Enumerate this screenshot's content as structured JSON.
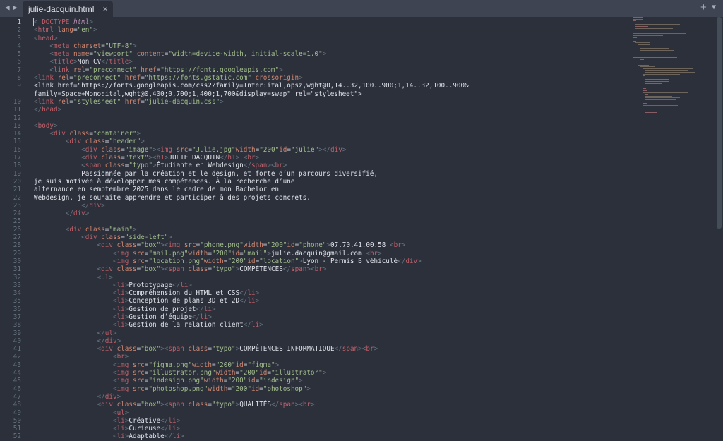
{
  "tabbar": {
    "nav_back": "◀",
    "nav_forward": "▶",
    "tab_title": "julie-dacquin.html",
    "tab_close": "×",
    "new_tab": "+",
    "menu": "▼"
  },
  "editor": {
    "active_line": 1,
    "lines": [
      {
        "n": "1",
        "t": "<!DOCTYPE html>"
      },
      {
        "n": "2",
        "t": "<html lang=\"en\">"
      },
      {
        "n": "3",
        "t": "<head>"
      },
      {
        "n": "4",
        "t": "    <meta charset=\"UTF-8\">"
      },
      {
        "n": "5",
        "t": "    <meta name=\"viewport\" content=\"width=device-width, initial-scale=1.0\">"
      },
      {
        "n": "6",
        "t": "    <title>Mon CV</title>"
      },
      {
        "n": "7",
        "t": "    <link rel=\"preconnect\" href=\"https://fonts.googleapis.com\">"
      },
      {
        "n": "8",
        "t": "<link rel=\"preconnect\" href=\"https://fonts.gstatic.com\" crossorigin>"
      },
      {
        "n": "9",
        "t": "<link href=\"https://fonts.googleapis.com/css2?family=Inter:ital,opsz,wght@0,14..32,100..900;1,14..32,100..900&"
      },
      {
        "n": "",
        "t": "family=Space+Mono:ital,wght@0,400;0,700;1,400;1,700&display=swap\" rel=\"stylesheet\">"
      },
      {
        "n": "10",
        "t": "<link rel=\"stylesheet\" href=\"julie-dacquin.css\">"
      },
      {
        "n": "11",
        "t": "</head>"
      },
      {
        "n": "12",
        "t": ""
      },
      {
        "n": "13",
        "t": "<body>"
      },
      {
        "n": "14",
        "t": "    <div class=\"container\">"
      },
      {
        "n": "15",
        "t": "        <div class=\"header\">"
      },
      {
        "n": "16",
        "t": "            <div class=\"image\"><img src=\"Julie.jpg\"width=\"200\"id=\"julie\"></div>"
      },
      {
        "n": "17",
        "t": "            <div class=\"text\"><h1>JULIE DACQUIN</h1> <br>"
      },
      {
        "n": "18",
        "t": "            <span class=\"typo\">Étudiante en Webdesign</span><br>"
      },
      {
        "n": "19",
        "t": "            Passionnée par la création et le design, et forte d’un parcours diversifié,"
      },
      {
        "n": "20",
        "t": "je suis motivée à développer mes compétences. À la recherche d’une"
      },
      {
        "n": "21",
        "t": "alternance en semptembre 2025 dans le cadre de mon Bachelor en"
      },
      {
        "n": "22",
        "t": "Webdesign, je souhaite apprendre et participer à des projets concrets."
      },
      {
        "n": "23",
        "t": "            </div>"
      },
      {
        "n": "24",
        "t": "        </div>"
      },
      {
        "n": "25",
        "t": ""
      },
      {
        "n": "26",
        "t": "        <div class=\"main\">"
      },
      {
        "n": "27",
        "t": "            <div class=\"side-left\">"
      },
      {
        "n": "28",
        "t": "                <div class=\"box\"><img src=\"phone.png\"width=\"200\"id=\"phone\">07.70.41.00.58 <br>"
      },
      {
        "n": "29",
        "t": "                    <img src=\"mail.png\"width=\"200\"id=\"mail\">julie.dacquin@gmail.com <br>"
      },
      {
        "n": "30",
        "t": "                    <img src=\"location.png\"width=\"200\"id=\"location\">Lyon - Permis B véhiculé</div>"
      },
      {
        "n": "31",
        "t": "                <div class=\"box\"><span class=\"typo\">COMPÉTENCES</span><br>"
      },
      {
        "n": "32",
        "t": "                <ul>"
      },
      {
        "n": "33",
        "t": "                    <li>Prototypage</li>"
      },
      {
        "n": "34",
        "t": "                    <li>Compréhension du HTML et CSS</li>"
      },
      {
        "n": "35",
        "t": "                    <li>Conception de plans 3D et 2D</li>"
      },
      {
        "n": "36",
        "t": "                    <li>Gestion de projet</li>"
      },
      {
        "n": "37",
        "t": "                    <li>Gestion d’équipe</li>"
      },
      {
        "n": "38",
        "t": "                    <li>Gestion de la relation client</li>"
      },
      {
        "n": "39",
        "t": "                </ul>"
      },
      {
        "n": "40",
        "t": "                </div>"
      },
      {
        "n": "41",
        "t": "                <div class=\"box\"><span class=\"typo\">COMPÉTENCES INFORMATIQUE</span><br>"
      },
      {
        "n": "42",
        "t": "                    <br>"
      },
      {
        "n": "43",
        "t": "                    <img src=\"figma.png\"width=\"200\"id=\"figma\">"
      },
      {
        "n": "44",
        "t": "                    <img src=\"illustrator.png\"width=\"200\"id=\"illustrator\">"
      },
      {
        "n": "45",
        "t": "                    <img src=\"indesign.png\"width=\"200\"id=\"indesign\">"
      },
      {
        "n": "46",
        "t": "                    <img src=\"photoshop.png\"width=\"200\"id=\"photoshop\">"
      },
      {
        "n": "47",
        "t": "                </div>"
      },
      {
        "n": "48",
        "t": "                <div class=\"box\"><span class=\"typo\">QUALITÉS</span><br>"
      },
      {
        "n": "49",
        "t": "                    <ul>"
      },
      {
        "n": "50",
        "t": "                    <li>Créative</li>"
      },
      {
        "n": "51",
        "t": "                    <li>Curieuse</li>"
      },
      {
        "n": "52",
        "t": "                    <li>Adaptable</li>"
      }
    ]
  },
  "colors": {
    "background": "#2b303b",
    "tabbar": "#3e4451",
    "tag": "#bf616a",
    "attribute": "#d08770",
    "string": "#a3be8c",
    "text": "#dfe1e8",
    "line_number": "#65737e"
  },
  "icons": {
    "nav_back": "chevron-left-icon",
    "nav_forward": "chevron-right-icon",
    "close": "close-icon",
    "new_tab": "plus-icon",
    "menu": "chevron-down-icon"
  }
}
